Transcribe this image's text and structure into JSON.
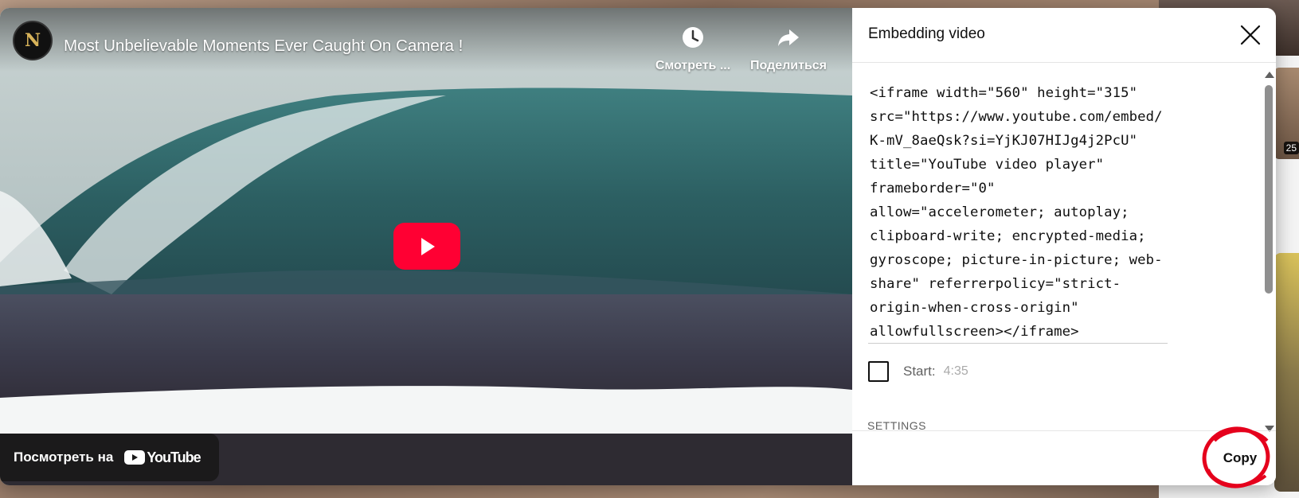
{
  "video": {
    "channel_avatar_letter": "N",
    "title": "Most Unbelievable Moments Ever Caught On Camera !",
    "watch_later_label": "Смотреть ...",
    "share_label": "Поделиться",
    "watch_on_label": "Посмотреть на",
    "youtube_logo_text": "YouTube"
  },
  "panel": {
    "title": "Embedding video",
    "embed_code": "<iframe width=\"560\" height=\"315\"\nsrc=\"https://www.youtube.com/embed/\nK-mV_8aeQsk?si=YjKJ07HIJg4j2PcU\"\ntitle=\"YouTube video player\"\nframeborder=\"0\"\nallow=\"accelerometer; autoplay;\nclipboard-write; encrypted-media;\ngyroscope; picture-in-picture; web-\nshare\" referrerpolicy=\"strict-\norigin-when-cross-origin\"\nallowfullscreen></iframe>",
    "start_label": "Start:",
    "start_time": "4:35",
    "start_checked": false,
    "settings_label": "SETTINGS",
    "copy_label": "Copy"
  },
  "background": {
    "thumb_duration": "25"
  },
  "colors": {
    "play_button": "#ff0033",
    "annotation_circle": "#e5001c",
    "panel_bg": "#ffffff"
  },
  "icons": {
    "watch_later": "clock-icon",
    "share": "share-arrow-icon",
    "close": "close-icon",
    "play": "play-icon"
  }
}
